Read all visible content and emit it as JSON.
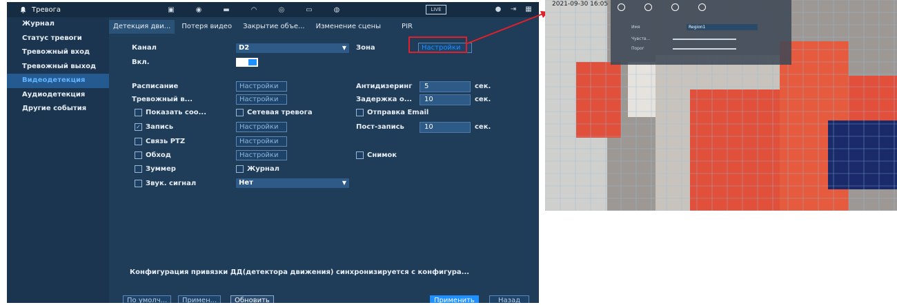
{
  "app": {
    "title": "Тревога"
  },
  "topbar": {
    "live_label": "LIVE"
  },
  "sidebar": {
    "items": [
      {
        "label": "Журнал"
      },
      {
        "label": "Статус тревоги"
      },
      {
        "label": "Тревожный вход"
      },
      {
        "label": "Тревожный выход"
      },
      {
        "label": "Видеодетекция"
      },
      {
        "label": "Аудиодетекция"
      },
      {
        "label": "Другие события"
      }
    ]
  },
  "tabs": [
    {
      "label": "Детекция дви..."
    },
    {
      "label": "Потеря видео"
    },
    {
      "label": "Закрытие объе..."
    },
    {
      "label": "Изменение сцены"
    },
    {
      "label": "PIR"
    }
  ],
  "form": {
    "channel_label": "Канал",
    "channel_value": "D2",
    "zone_label": "Зона",
    "zone_button": "Настройки",
    "enable_label": "Вкл.",
    "schedule_label": "Расписание",
    "schedule_button": "Настройки",
    "antidither_label": "Антидизеринг",
    "antidither_value": "5",
    "antidither_unit": "сек.",
    "alarm_out_label": "Тревожный в...",
    "alarm_out_button": "Настройки",
    "delay_label": "Задержка о...",
    "delay_value": "10",
    "delay_unit": "сек.",
    "show_msg_label": "Показать соо...",
    "net_alarm_label": "Сетевая тревога",
    "email_label": "Отправка Email",
    "record_label": "Запись",
    "record_button": "Настройки",
    "post_record_label": "Пост-запись",
    "post_record_value": "10",
    "post_record_unit": "сек.",
    "ptz_label": "Связь PTZ",
    "ptz_button": "Настройки",
    "tour_label": "Обход",
    "tour_button": "Настройки",
    "snapshot_label": "Снимок",
    "buzzer_label": "Зуммер",
    "log_label": "Журнал",
    "sound_label": "Звук. сигнал",
    "sound_value": "Нет"
  },
  "info_text": "Конфигурация привязки ДД(детектора движения) синхронизируется с конфигура...",
  "buttons": {
    "default": "По умолч...",
    "apply_copy": "Примен...",
    "refresh": "Обновить",
    "apply": "Применить",
    "back": "Назад"
  },
  "camera": {
    "osd_datetime": "2021-09-30 16:05",
    "panel_name_label": "Имя",
    "panel_region": "Region1",
    "panel_sensitivity": "Чувств...",
    "panel_threshold": "Порог"
  },
  "colors": {
    "accent": "#1e90ff",
    "highlight": "#e0202a",
    "grid_fill": "#f0502a"
  }
}
